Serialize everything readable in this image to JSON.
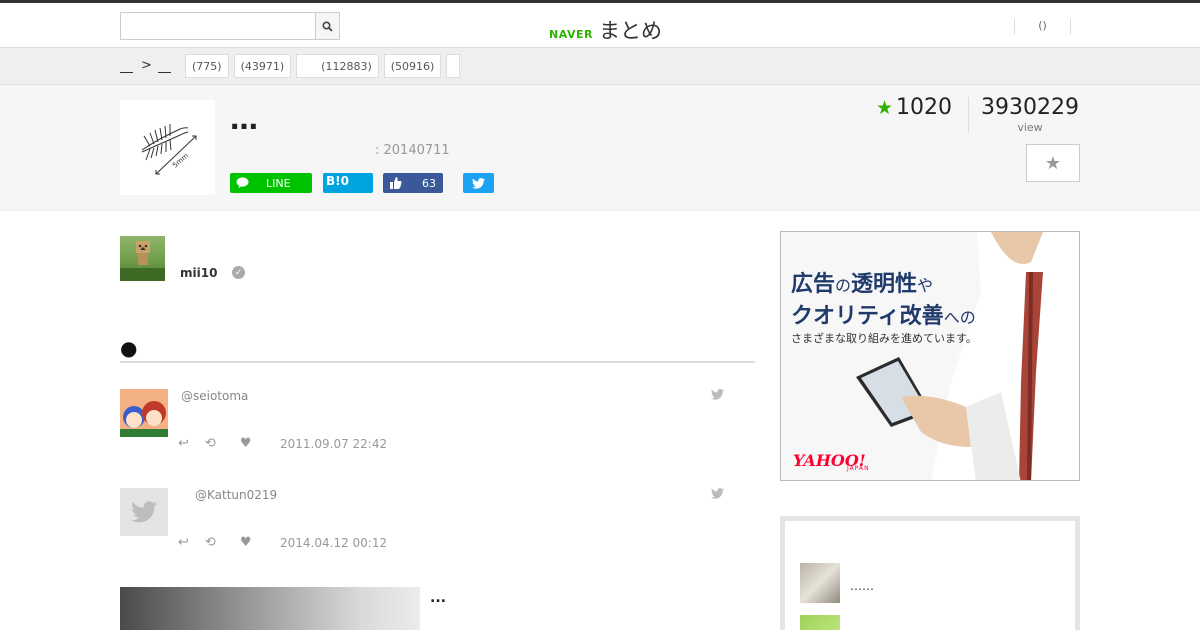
{
  "header": {
    "search": {
      "placeholder": "",
      "value": ""
    },
    "logo": {
      "naver": "NAVER",
      "matome": "まとめ"
    },
    "user_link": "()"
  },
  "category_bar": {
    "breadcrumb_sep": ">",
    "tags": [
      "(775)",
      "(43971)",
      "(112883)",
      "(50916)",
      ""
    ]
  },
  "article": {
    "title": "…",
    "date": ": 20140711",
    "share": {
      "line": "LINE",
      "hatena": "B!0",
      "facebook_count": "63"
    },
    "fav_count": "1020",
    "views": "3930229",
    "views_label": "view",
    "author": {
      "name": "mii10",
      "verified_icon": "✓"
    }
  },
  "content": {
    "section_bullet": "●",
    "tweets": [
      {
        "user": "@seiotoma",
        "date": "2011.09.07 22:42"
      },
      {
        "user": "@Kattun0219",
        "date": "2014.04.12 00:12"
      }
    ],
    "item_title": "..."
  },
  "sidebar": {
    "ad": {
      "line1_big": "広告",
      "line1_small": "の",
      "line1_big2": "透明性",
      "line1_small2": "や",
      "line2_big": "クオリティ改善",
      "line2_small": "への",
      "line3": "さまざまな取り組みを進めています。",
      "logo": "YAHOO!",
      "logo_sub": "JAPAN"
    },
    "related": [
      {
        "title": "……"
      },
      {
        "title": ""
      }
    ]
  },
  "colors": {
    "naver_green": "#2db400",
    "line_green": "#00c300",
    "hatena_blue": "#00a4de",
    "facebook_blue": "#3b5998",
    "twitter_blue": "#1da1f2",
    "ad_navy": "#1f3a6b",
    "yahoo_red": "#ff0033"
  },
  "icons": {
    "search": "search-icon",
    "star": "star-icon",
    "twitter": "twitter-bird-icon",
    "reply": "reply-icon",
    "retweet": "retweet-icon",
    "like": "heart-icon"
  }
}
